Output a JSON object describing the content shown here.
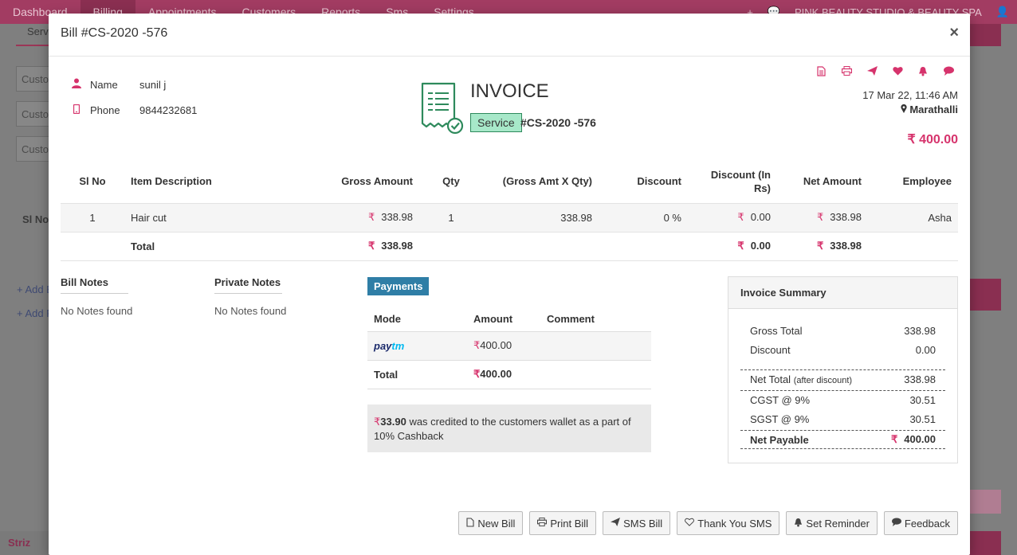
{
  "topnav": {
    "items": [
      "Dashboard",
      "Billing",
      "Appointments",
      "Customers",
      "Reports",
      "Sms",
      "Settings"
    ],
    "active_index": 1,
    "studio_name": "PINK BEAUTY STUDIO & BEAUTY SPA",
    "plus_icon": "+",
    "chat_icon": "💬",
    "user_icon": "👤"
  },
  "background": {
    "tab_label": "Serv",
    "field_placeholder": "Custo",
    "sl_no": "Sl No",
    "add_link_1": "+ Add B",
    "add_link_2": "+ Add P",
    "logo": "Striz"
  },
  "modal": {
    "title": "Bill #CS-2020 -576",
    "close": "×"
  },
  "customer": {
    "name_label": "Name",
    "name_value": "sunil j",
    "phone_label": "Phone",
    "phone_value": "9844232681"
  },
  "invoice": {
    "heading": "INVOICE",
    "type_badge": "Service",
    "number": "#CS-2020 -576",
    "date": "17 Mar 22, 11:46 AM",
    "location": "Marathalli",
    "location_icon": "📍",
    "total": "₹ 400.00",
    "action_icons": [
      "doc-icon",
      "print-icon",
      "send-icon",
      "heart-icon",
      "bell-icon",
      "comment-icon"
    ]
  },
  "items_table": {
    "headers": [
      "Sl No",
      "Item Description",
      "Gross Amount",
      "Qty",
      "(Gross Amt X Qty)",
      "Discount",
      "Discount (In Rs)",
      "Net Amount",
      "Employee"
    ],
    "rows": [
      {
        "sl": "1",
        "desc": "Hair cut",
        "gross": "338.98",
        "qty": "1",
        "gross_qty": "338.98",
        "discount": "0 %",
        "discount_rs": "0.00",
        "net": "338.98",
        "employee": "Asha"
      }
    ],
    "total": {
      "label": "Total",
      "gross": "338.98",
      "discount_rs": "0.00",
      "net": "338.98"
    },
    "currency": "₹"
  },
  "notes": {
    "bill_label": "Bill Notes",
    "bill_value": "No Notes found",
    "private_label": "Private Notes",
    "private_value": "No Notes found"
  },
  "payments": {
    "badge": "Payments",
    "headers": [
      "Mode",
      "Amount",
      "Comment"
    ],
    "rows": [
      {
        "mode_p1": "pay",
        "mode_p2": "tm",
        "amount": "400.00",
        "comment": ""
      }
    ],
    "total_label": "Total",
    "total_amount": "400.00",
    "cashback_amount": "33.90",
    "cashback_text": " was credited to the customers wallet as a part of 10% Cashback"
  },
  "summary": {
    "heading": "Invoice Summary",
    "gross_label": "Gross Total",
    "gross_value": "338.98",
    "discount_label": "Discount",
    "discount_value": "0.00",
    "net_label": "Net Total",
    "net_note": "(after discount)",
    "net_value": "338.98",
    "cgst_label": "CGST @ 9%",
    "cgst_value": "30.51",
    "sgst_label": "SGST @ 9%",
    "sgst_value": "30.51",
    "payable_label": "Net Payable",
    "payable_value": "400.00"
  },
  "buttons": {
    "new_bill": "New Bill",
    "print_bill": "Print Bill",
    "sms_bill": "SMS Bill",
    "thank_you": "Thank You SMS",
    "reminder": "Set Reminder",
    "feedback": "Feedback"
  },
  "colors": {
    "accent": "#d6336c",
    "nav": "#a23c62",
    "payments_badge": "#2f7ea6",
    "service_badge": "#a7e8c9",
    "invoice_icon": "#2e8a5c"
  }
}
